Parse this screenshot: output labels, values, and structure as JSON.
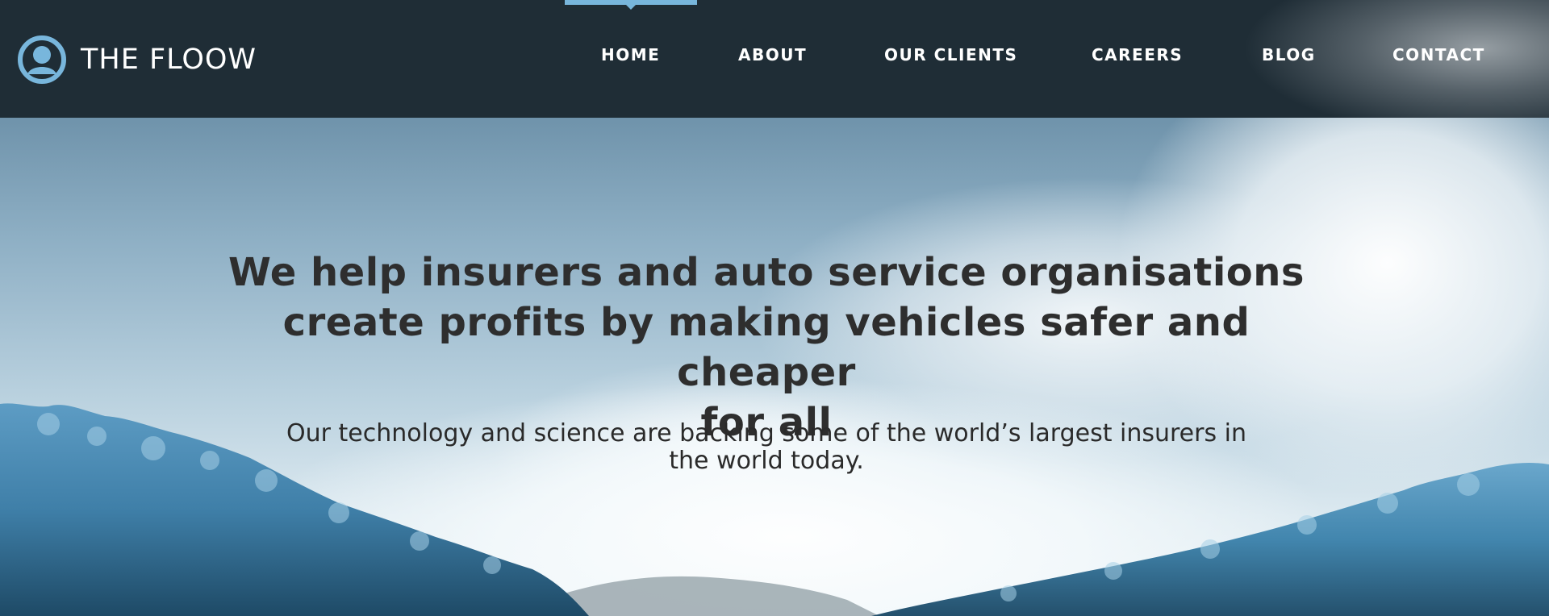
{
  "brand": {
    "name": "THE FLOOW",
    "accent_color": "#78b6dc"
  },
  "nav": {
    "items": [
      "HOME",
      "ABOUT",
      "OUR CLIENTS",
      "CAREERS",
      "BLOG",
      "CONTACT"
    ],
    "active": "HOME"
  },
  "hero": {
    "headline_lines": [
      "We help insurers and auto service organisations",
      "create profits by making vehicles safer and cheaper",
      "for all"
    ],
    "subline_lines": [
      "Our technology and science are backing some of the world’s largest insurers in",
      "the world today."
    ]
  }
}
